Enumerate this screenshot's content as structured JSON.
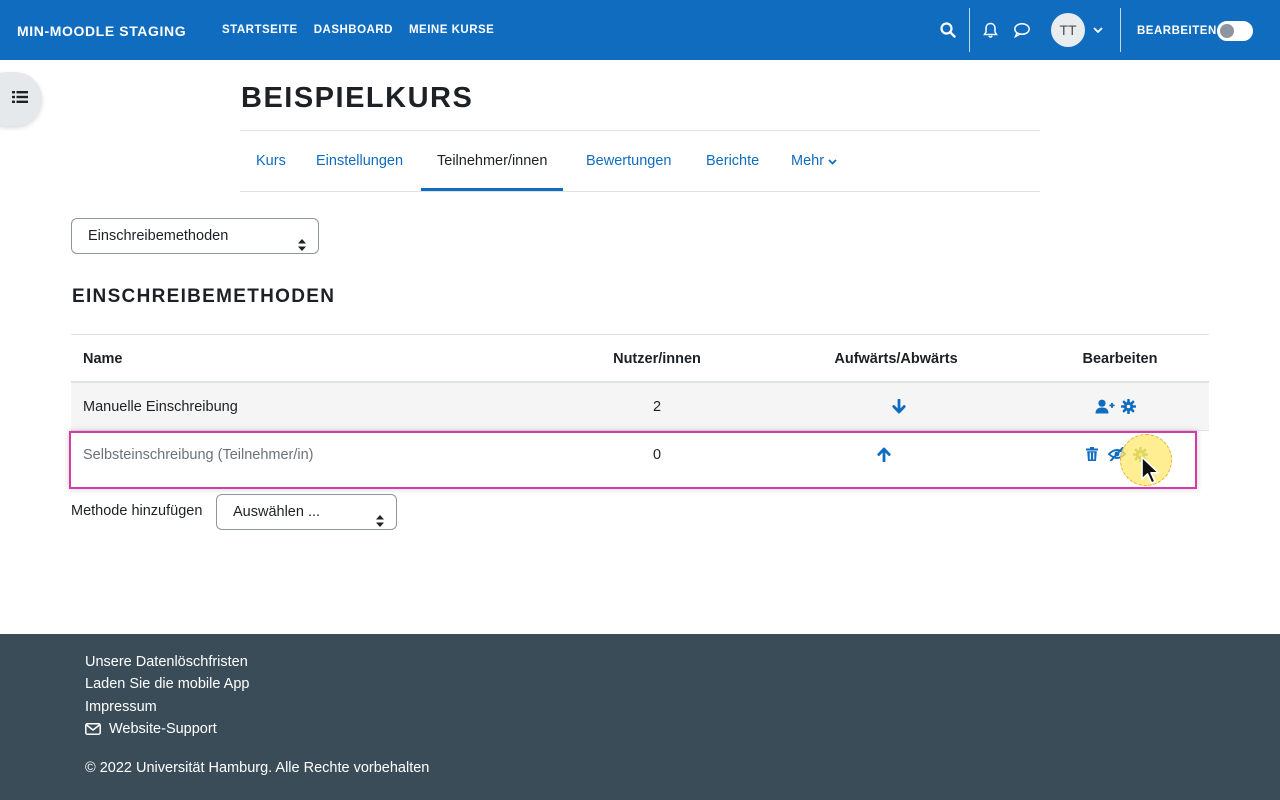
{
  "navbar": {
    "brand": "MIN-MOODLE STAGING",
    "links": [
      "STARTSEITE",
      "DASHBOARD",
      "MEINE KURSE"
    ],
    "avatar_initials": "TT",
    "edit_mode_label": "BEARBEITEN",
    "edit_mode_on": false,
    "bg_color": "#0f6cbf"
  },
  "course": {
    "title": "BEISPIELKURS",
    "tabs": [
      {
        "label": "Kurs",
        "active": false
      },
      {
        "label": "Einstellungen",
        "active": false
      },
      {
        "label": "Teilnehmer/innen",
        "active": true
      },
      {
        "label": "Bewertungen",
        "active": false
      },
      {
        "label": "Berichte",
        "active": false
      },
      {
        "label": "Mehr",
        "active": false
      }
    ]
  },
  "page_select": {
    "value": "Einschreibemethoden"
  },
  "section": {
    "title": "EINSCHREIBEMETHODEN"
  },
  "table": {
    "headers": {
      "name": "Name",
      "users": "Nutzer/innen",
      "move": "Aufwärts/Abwärts",
      "edit": "Bearbeiten"
    },
    "rows": [
      {
        "name": "Manuelle Einschreibung",
        "users": "2",
        "move_icon": "arrow-down-icon",
        "edit_icons": [
          "user-plus-icon",
          "gear-icon"
        ],
        "disabled": false
      },
      {
        "name": "Selbsteinschreibung (Teilnehmer/in)",
        "users": "0",
        "move_icon": "arrow-up-icon",
        "edit_icons": [
          "trash-icon",
          "eye-slash-icon",
          "gear-icon"
        ],
        "disabled": true
      }
    ]
  },
  "add_method": {
    "label": "Methode hinzufügen",
    "select_value": "Auswählen ..."
  },
  "footer": {
    "links": [
      "Unsere Datenlöschfristen",
      "Laden Sie die mobile App",
      "Impressum",
      "Website-Support"
    ],
    "copyright": "© 2022 Universität Hamburg. Alle Rechte vorbehalten",
    "bg_color": "#3a4c58"
  }
}
